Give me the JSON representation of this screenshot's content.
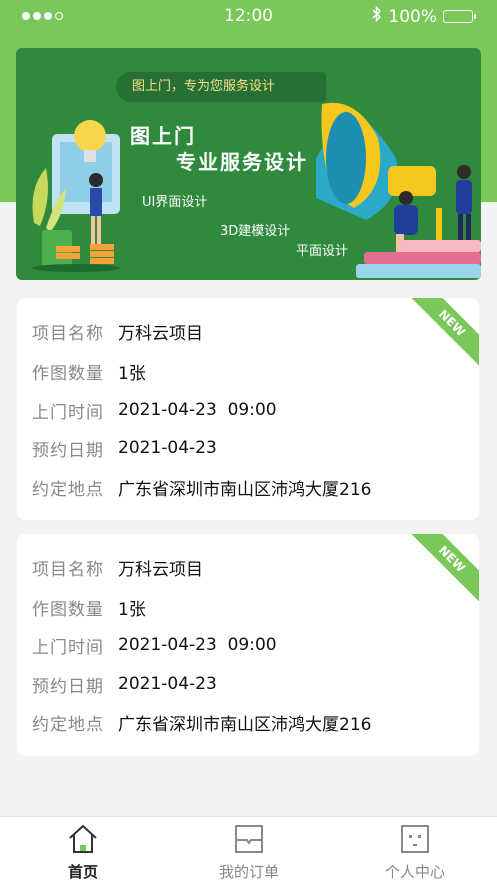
{
  "status_bar": {
    "time": "12:00",
    "battery": "100%"
  },
  "banner": {
    "tagline": "图上门，专为您服务设计",
    "title_line1": "图上门",
    "title_line2": "专业服务设计",
    "services": [
      "UI界面设计",
      "3D建模设计",
      "平面设计"
    ]
  },
  "orders": [
    {
      "badge": "NEW",
      "fields": [
        {
          "label": "项目名称",
          "value": "万科云项目"
        },
        {
          "label": "作图数量",
          "value": "1张"
        },
        {
          "label": "上门时间",
          "value": "2021-04-23  09:00"
        },
        {
          "label": "预约日期",
          "value": "2021-04-23"
        },
        {
          "label": "约定地点",
          "value": "广东省深圳市南山区沛鸿大厦216"
        }
      ]
    },
    {
      "badge": "NEW",
      "fields": [
        {
          "label": "项目名称",
          "value": "万科云项目"
        },
        {
          "label": "作图数量",
          "value": "1张"
        },
        {
          "label": "上门时间",
          "value": "2021-04-23  09:00"
        },
        {
          "label": "预约日期",
          "value": "2021-04-23"
        },
        {
          "label": "约定地点",
          "value": "广东省深圳市南山区沛鸿大厦216"
        }
      ]
    }
  ],
  "tabbar": {
    "items": [
      {
        "label": "首页",
        "icon": "home-icon",
        "active": true
      },
      {
        "label": "我的订单",
        "icon": "order-icon",
        "active": false
      },
      {
        "label": "个人中心",
        "icon": "profile-icon",
        "active": false
      }
    ]
  },
  "colors": {
    "primary": "#7ac85a",
    "banner": "#2f8a3e"
  }
}
